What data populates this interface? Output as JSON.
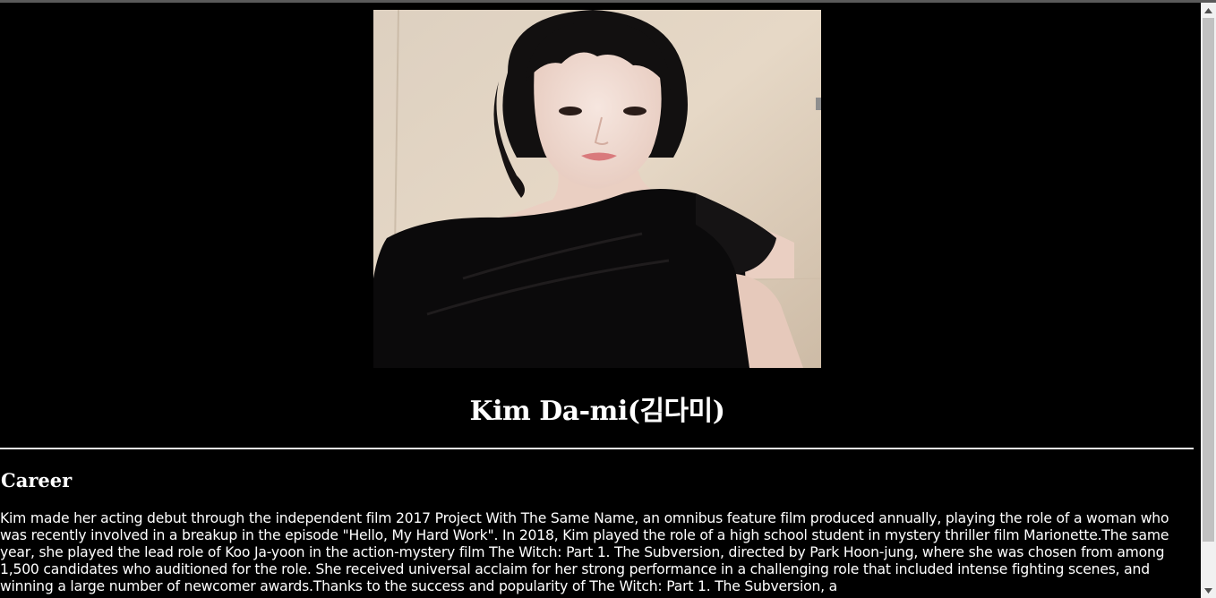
{
  "profile": {
    "name": "Kim Da-mi(김다미)",
    "photo_alt": "Kim Da-mi"
  },
  "career": {
    "heading": "Career",
    "text": "Kim made her acting debut through the independent film 2017 Project With The Same Name, an omnibus feature film produced annually, playing the role of a woman who was recently involved in a breakup in the episode \"Hello, My Hard Work\". In 2018, Kim played the role of a high school student in mystery thriller film Marionette.The same year, she played the lead role of Koo Ja-yoon in the action-mystery film The Witch: Part 1. The Subversion, directed by Park Hoon-jung, where she was chosen from among 1,500 candidates who auditioned for the role. She received universal acclaim for her strong performance in a challenging role that included intense fighting scenes, and winning a large number of newcomer awards.Thanks to the success and popularity of The Witch: Part 1. The Subversion, a"
  },
  "colors": {
    "background": "#000000",
    "text": "#ffffff",
    "scrollbar_track": "#f1f1f1",
    "scrollbar_thumb": "#c1c1c1"
  },
  "icons": {
    "scroll_up": "triangle-up-icon",
    "scroll_down": "triangle-down-icon"
  }
}
